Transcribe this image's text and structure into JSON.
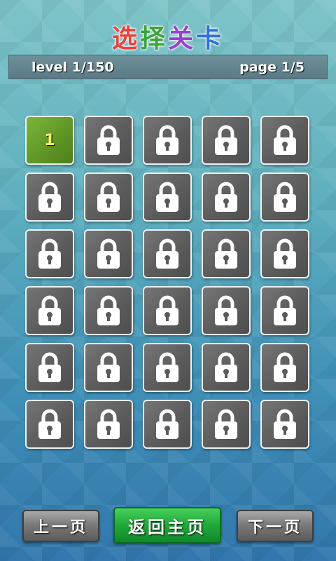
{
  "title": {
    "chars": [
      "选",
      "择",
      "关",
      "卡"
    ],
    "colors": [
      "#e8443c",
      "#3aa33a",
      "#9b3fd0",
      "#2f6fd8"
    ]
  },
  "info": {
    "level": "level 1/150",
    "page": "page 1/5"
  },
  "grid": {
    "columns": 5,
    "rows": 6,
    "tiles": [
      {
        "status": "unlocked",
        "label": "1"
      },
      {
        "status": "locked"
      },
      {
        "status": "locked"
      },
      {
        "status": "locked"
      },
      {
        "status": "locked"
      },
      {
        "status": "locked"
      },
      {
        "status": "locked"
      },
      {
        "status": "locked"
      },
      {
        "status": "locked"
      },
      {
        "status": "locked"
      },
      {
        "status": "locked"
      },
      {
        "status": "locked"
      },
      {
        "status": "locked"
      },
      {
        "status": "locked"
      },
      {
        "status": "locked"
      },
      {
        "status": "locked"
      },
      {
        "status": "locked"
      },
      {
        "status": "locked"
      },
      {
        "status": "locked"
      },
      {
        "status": "locked"
      },
      {
        "status": "locked"
      },
      {
        "status": "locked"
      },
      {
        "status": "locked"
      },
      {
        "status": "locked"
      },
      {
        "status": "locked"
      },
      {
        "status": "locked"
      },
      {
        "status": "locked"
      },
      {
        "status": "locked"
      },
      {
        "status": "locked"
      },
      {
        "status": "locked"
      }
    ],
    "locked_icon": "lock-icon"
  },
  "buttons": {
    "prev_page": "上一页",
    "home": "返回主页",
    "next_page": "下一页"
  }
}
